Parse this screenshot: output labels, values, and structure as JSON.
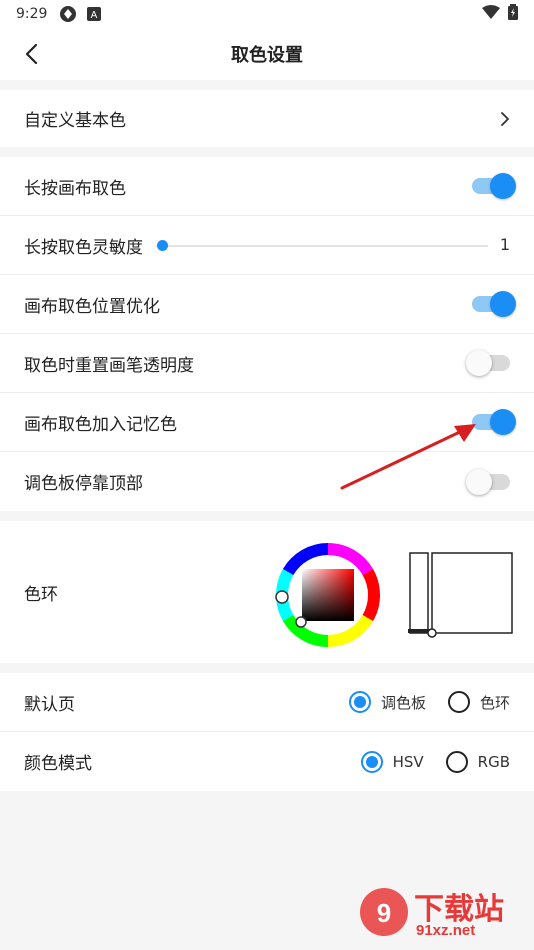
{
  "status": {
    "time": "9:29"
  },
  "header": {
    "title": "取色设置"
  },
  "section_custom": {
    "label": "自定义基本色",
    "chevron": "chevron-right-icon"
  },
  "settings": {
    "long_press_pick": {
      "label": "长按画布取色",
      "enabled": true
    },
    "sensitivity": {
      "label": "长按取色灵敏度",
      "value": "1"
    },
    "position_opt": {
      "label": "画布取色位置优化",
      "enabled": true
    },
    "reset_opacity": {
      "label": "取色时重置画笔透明度",
      "enabled": false
    },
    "add_memory": {
      "label": "画布取色加入记忆色",
      "enabled": true
    },
    "palette_top": {
      "label": "调色板停靠顶部",
      "enabled": false
    }
  },
  "color_ring": {
    "label": "色环"
  },
  "default_page": {
    "label": "默认页",
    "options": [
      "调色板",
      "色环"
    ],
    "selected": "调色板"
  },
  "color_mode": {
    "label": "颜色模式",
    "options": [
      "HSV",
      "RGB"
    ],
    "selected": "HSV"
  },
  "watermark": {
    "text": "下载站",
    "url": "91xz.net"
  },
  "colors": {
    "accent": "#1a8ef5",
    "accent_track": "#8fc7f5",
    "arrow": "#d81e1e"
  }
}
